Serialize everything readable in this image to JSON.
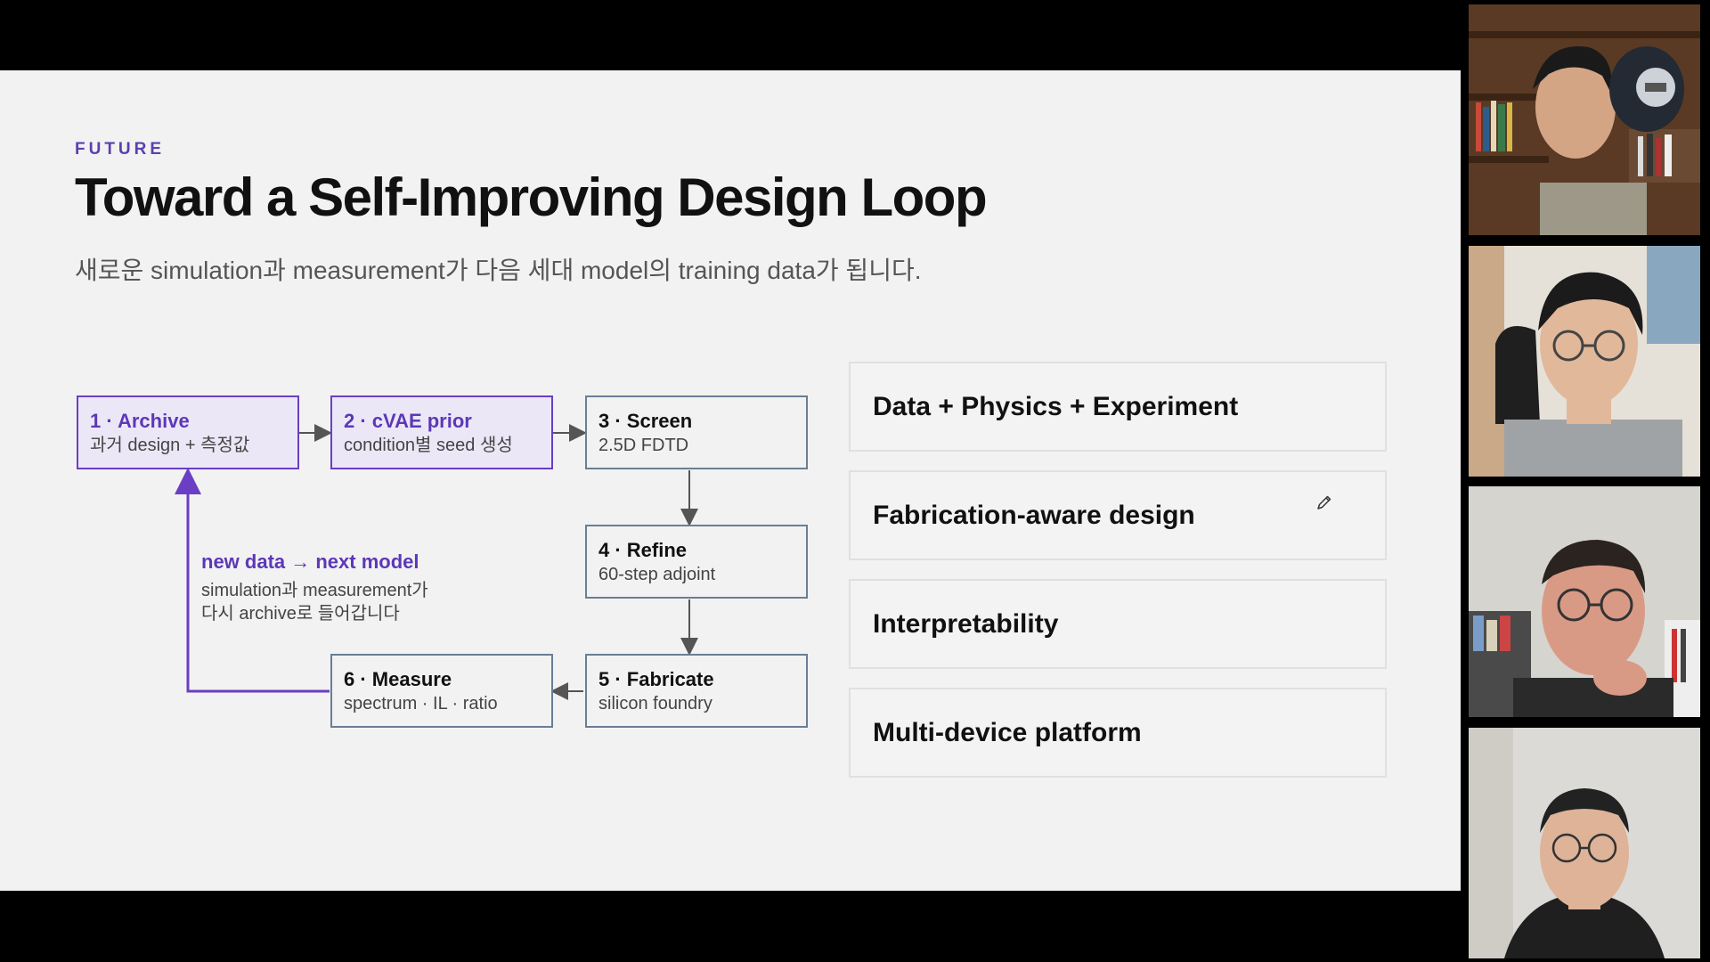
{
  "slide": {
    "eyebrow": "FUTURE",
    "title": "Toward a Self-Improving Design Loop",
    "subtitle": "새로운 simulation과 measurement가 다음 세대 model의 training data가 됩니다."
  },
  "loop": {
    "steps": [
      {
        "title": "1 · Archive",
        "sub": "과거 design + 측정값"
      },
      {
        "title": "2 · cVAE prior",
        "sub": "condition별 seed 생성"
      },
      {
        "title": "3 · Screen",
        "sub": "2.5D FDTD"
      },
      {
        "title": "4 · Refine",
        "sub": "60-step adjoint"
      },
      {
        "title": "5 · Fabricate",
        "sub": "silicon foundry"
      },
      {
        "title": "6 · Measure",
        "sub": "spectrum · IL · ratio"
      }
    ],
    "feedback_label": "new data → next model",
    "feedback_note_1": "simulation과 measurement가",
    "feedback_note_2": "다시 archive로 들어갑니다"
  },
  "cards": [
    {
      "label": "Data + Physics + Experiment"
    },
    {
      "label": "Fabrication-aware design"
    },
    {
      "label": "Interpretability"
    },
    {
      "label": "Multi-device platform"
    }
  ],
  "colors": {
    "accent": "#5c38b8",
    "box_border": "#6a7e93",
    "highlight_fill": "#ece7f7",
    "slide_bg": "#f2f2f2"
  },
  "icons": {
    "cursor": "pencil-icon"
  }
}
